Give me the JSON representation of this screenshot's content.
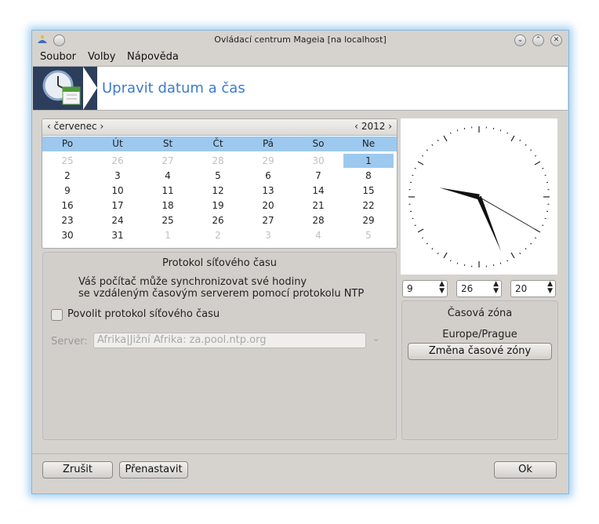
{
  "window": {
    "title": "Ovládací centrum Mageia  [na localhost]",
    "app_icon": "mageia-logo-icon",
    "controls": [
      "minimize-icon",
      "maximize-icon",
      "close-icon"
    ]
  },
  "menu": {
    "items": [
      "Soubor",
      "Volby",
      "Nápověda"
    ]
  },
  "banner": {
    "title": "Upravit datum a čas",
    "icon": "clock-calendar-icon"
  },
  "calendar": {
    "month": "červenec",
    "year": "2012",
    "weekdays": [
      "Po",
      "Út",
      "St",
      "Čt",
      "Pá",
      "So",
      "Ne"
    ],
    "weeks": [
      [
        "25",
        "26",
        "27",
        "28",
        "29",
        "30",
        "1"
      ],
      [
        "2",
        "3",
        "4",
        "5",
        "6",
        "7",
        "8"
      ],
      [
        "9",
        "10",
        "11",
        "12",
        "13",
        "14",
        "15"
      ],
      [
        "16",
        "17",
        "18",
        "19",
        "20",
        "21",
        "22"
      ],
      [
        "23",
        "24",
        "25",
        "26",
        "27",
        "28",
        "29"
      ],
      [
        "30",
        "31",
        "1",
        "2",
        "3",
        "4",
        "5"
      ]
    ],
    "selected_day": "1",
    "selection_color": "#9dc9ef"
  },
  "clock": {
    "hours": 9,
    "minutes": 26,
    "seconds": 20
  },
  "time_spinners": {
    "hours": "9",
    "minutes": "26",
    "seconds": "20"
  },
  "timezone": {
    "title": "Časová zóna",
    "value": "Europe/Prague",
    "change_button": "Změna časové zóny"
  },
  "ntp": {
    "title": "Protokol síťového času",
    "description_line1": "Váš počítač může synchronizovat své hodiny",
    "description_line2": "se vzdáleným časovým serverem pomocí protokolu NTP",
    "enable_label": "Povolit protokol síťového času",
    "enabled": false,
    "server_label": "Server:",
    "server_value": "Afrika|Jižní Afrika: za.pool.ntp.org"
  },
  "buttons": {
    "cancel": "Zrušit",
    "reset": "Přenastavit",
    "ok": "Ok"
  }
}
